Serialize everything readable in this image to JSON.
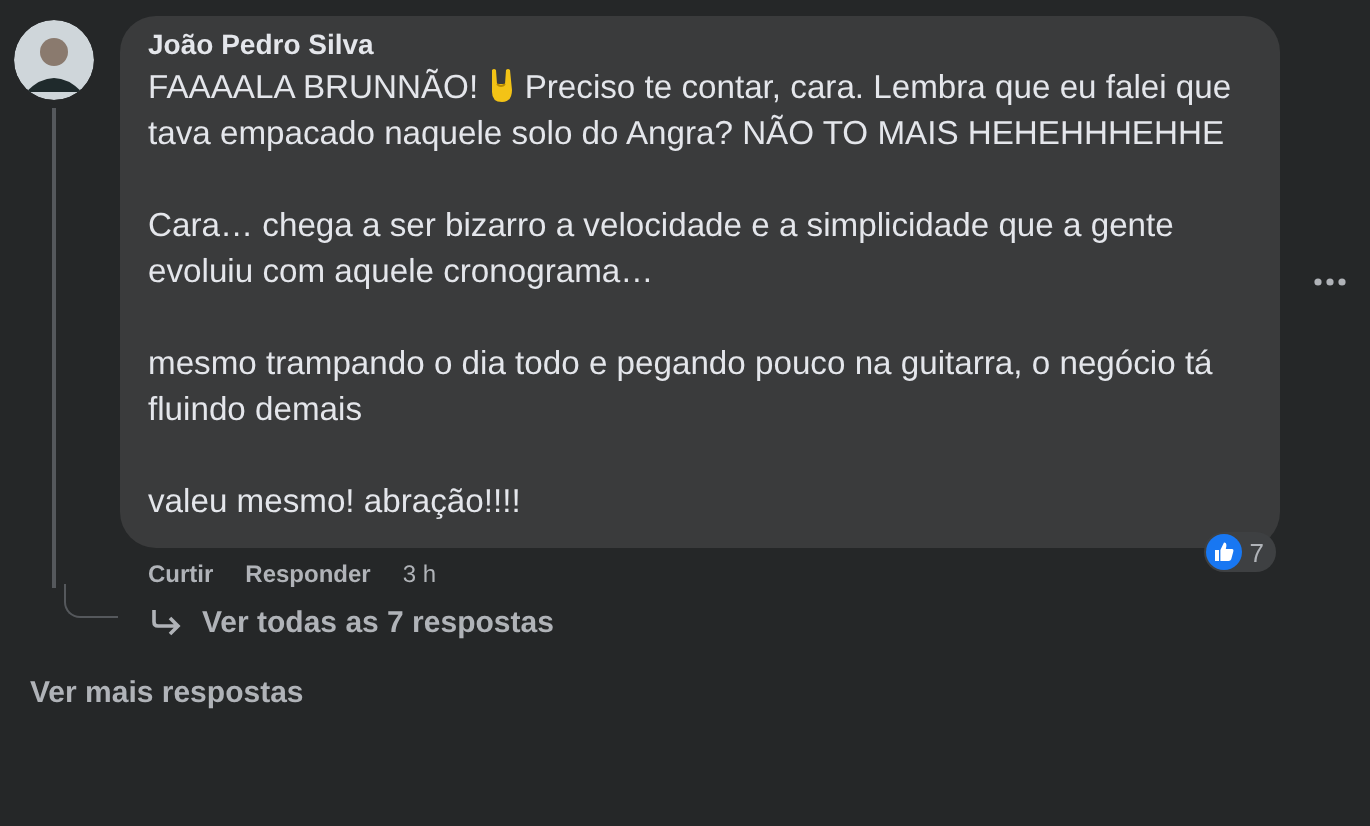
{
  "comment": {
    "author": "João Pedro Silva",
    "paragraphs": [
      {
        "kind": "emoji",
        "before": "FAAAALA BRUNNÃO!",
        "after": "Preciso te contar, cara. Lembra que eu falei que tava empacado naquele solo do Angra? NÃO TO MAIS HEHEHHHEHHE"
      },
      {
        "kind": "text",
        "text": "Cara… chega a ser bizarro a velocidade e a simplicidade que a gente evoluiu com aquele cronograma…"
      },
      {
        "kind": "text",
        "text": "mesmo trampando o dia todo e pegando pouco na guitarra, o negócio tá fluindo demais"
      },
      {
        "kind": "text",
        "text": "valeu mesmo! abração!!!!"
      }
    ],
    "reactions": {
      "count": "7"
    },
    "actions": [
      "Curtir",
      "Responder"
    ],
    "time": "3 h"
  },
  "replies_link": "Ver todas as 7 respostas",
  "more_replies": "Ver mais respostas"
}
